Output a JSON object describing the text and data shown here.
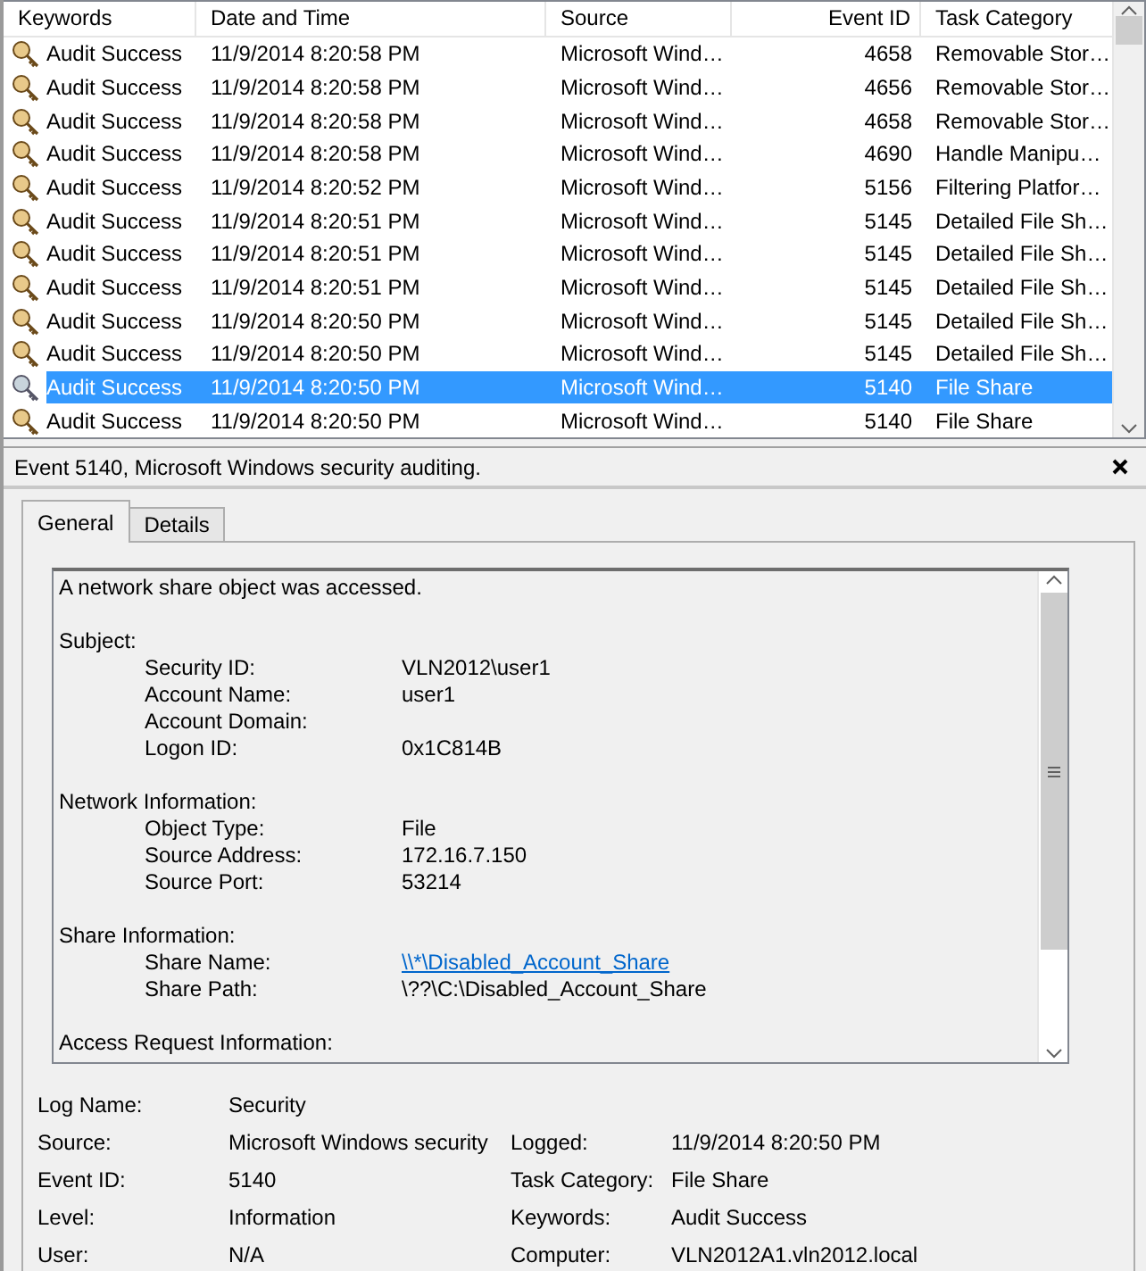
{
  "event_list": {
    "columns": [
      "Keywords",
      "Date and Time",
      "Source",
      "Event ID",
      "Task Category"
    ],
    "rows": [
      {
        "keywords": "Audit Success",
        "date_time": "11/9/2014 8:20:58 PM",
        "source": "Microsoft Wind…",
        "event_id": "4658",
        "task_category": "Removable Stor…",
        "selected": false
      },
      {
        "keywords": "Audit Success",
        "date_time": "11/9/2014 8:20:58 PM",
        "source": "Microsoft Wind…",
        "event_id": "4656",
        "task_category": "Removable Stor…",
        "selected": false
      },
      {
        "keywords": "Audit Success",
        "date_time": "11/9/2014 8:20:58 PM",
        "source": "Microsoft Wind…",
        "event_id": "4658",
        "task_category": "Removable Stor…",
        "selected": false
      },
      {
        "keywords": "Audit Success",
        "date_time": "11/9/2014 8:20:58 PM",
        "source": "Microsoft Wind…",
        "event_id": "4690",
        "task_category": "Handle Manipu…",
        "selected": false
      },
      {
        "keywords": "Audit Success",
        "date_time": "11/9/2014 8:20:52 PM",
        "source": "Microsoft Wind…",
        "event_id": "5156",
        "task_category": "Filtering Platfor…",
        "selected": false
      },
      {
        "keywords": "Audit Success",
        "date_time": "11/9/2014 8:20:51 PM",
        "source": "Microsoft Wind…",
        "event_id": "5145",
        "task_category": "Detailed File Sh…",
        "selected": false
      },
      {
        "keywords": "Audit Success",
        "date_time": "11/9/2014 8:20:51 PM",
        "source": "Microsoft Wind…",
        "event_id": "5145",
        "task_category": "Detailed File Sh…",
        "selected": false
      },
      {
        "keywords": "Audit Success",
        "date_time": "11/9/2014 8:20:51 PM",
        "source": "Microsoft Wind…",
        "event_id": "5145",
        "task_category": "Detailed File Sh…",
        "selected": false
      },
      {
        "keywords": "Audit Success",
        "date_time": "11/9/2014 8:20:50 PM",
        "source": "Microsoft Wind…",
        "event_id": "5145",
        "task_category": "Detailed File Sh…",
        "selected": false
      },
      {
        "keywords": "Audit Success",
        "date_time": "11/9/2014 8:20:50 PM",
        "source": "Microsoft Wind…",
        "event_id": "5145",
        "task_category": "Detailed File Sh…",
        "selected": false
      },
      {
        "keywords": "Audit Success",
        "date_time": "11/9/2014 8:20:50 PM",
        "source": "Microsoft Wind…",
        "event_id": "5140",
        "task_category": "File Share",
        "selected": true
      },
      {
        "keywords": "Audit Success",
        "date_time": "11/9/2014 8:20:50 PM",
        "source": "Microsoft Wind…",
        "event_id": "5140",
        "task_category": "File Share",
        "selected": false
      }
    ]
  },
  "event_details": {
    "title": "Event 5140, Microsoft Windows security auditing.",
    "tabs": [
      {
        "label": "General",
        "selected": true
      },
      {
        "label": "Details",
        "selected": false
      }
    ],
    "description": {
      "summary": "A network share object was accessed.",
      "sections": [
        {
          "heading": "Subject:",
          "items": [
            {
              "label": "Security ID:",
              "value": "VLN2012\\user1"
            },
            {
              "label": "Account Name:",
              "value": "user1"
            },
            {
              "label": "Account Domain:"
            },
            {
              "label": "Logon ID:",
              "value": "0x1C814B"
            }
          ]
        },
        {
          "heading": "Network Information:",
          "items": [
            {
              "label": "Object Type:",
              "value": "File"
            },
            {
              "label": "Source Address:",
              "value": "172.16.7.150"
            },
            {
              "label": "Source Port:",
              "value": "53214"
            }
          ]
        },
        {
          "heading": "Share Information:",
          "items": [
            {
              "label": "Share Name:",
              "value": "\\\\*\\Disabled_Account_Share",
              "kind": "link"
            },
            {
              "label": "Share Path:",
              "value": "\\??\\C:\\Disabled_Account_Share"
            }
          ]
        },
        {
          "heading": "Access Request Information:"
        }
      ]
    },
    "fields": [
      {
        "left": {
          "label": "Log Name:",
          "value": "Security"
        }
      },
      {
        "left": {
          "label": "Source:",
          "value": "Microsoft Windows security"
        },
        "right": {
          "label": "Logged:",
          "value": "11/9/2014 8:20:50 PM"
        }
      },
      {
        "left": {
          "label": "Event ID:",
          "value": "5140"
        },
        "right": {
          "label": "Task Category:",
          "value": "File Share"
        }
      },
      {
        "left": {
          "label": "Level:",
          "value": "Information"
        },
        "right": {
          "label": "Keywords:",
          "value": "Audit Success"
        }
      },
      {
        "left": {
          "label": "User:",
          "value": "N/A"
        },
        "right": {
          "label": "Computer:",
          "value": "VLN2012A1.vln2012.local"
        }
      }
    ]
  }
}
